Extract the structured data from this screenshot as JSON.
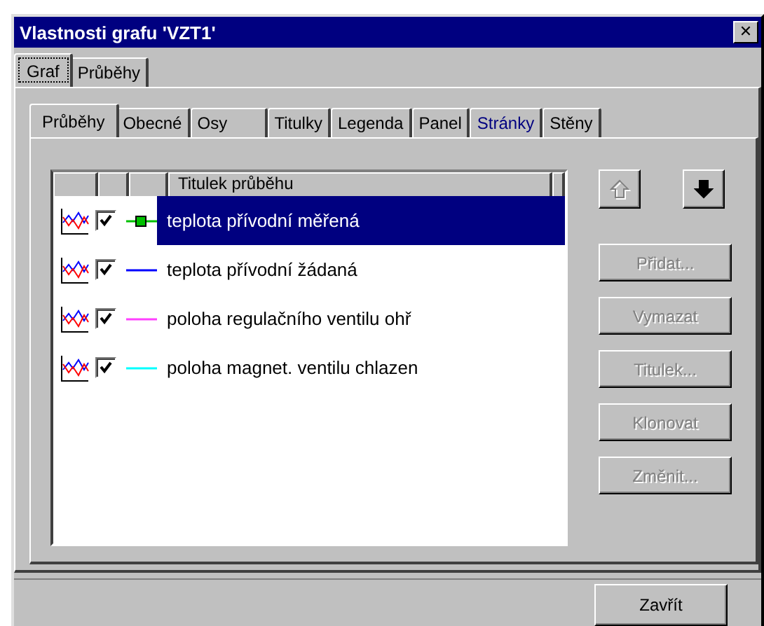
{
  "window": {
    "title": "Vlastnosti grafu 'VZT1'",
    "close": "✕"
  },
  "outer_tabs": [
    {
      "label": "Graf",
      "selected": true
    },
    {
      "label": "Průběhy",
      "selected": false
    }
  ],
  "inner_tabs": [
    {
      "label": "Průběhy",
      "selected": true,
      "hot": false
    },
    {
      "label": "Obecné",
      "selected": false,
      "hot": false
    },
    {
      "label": "Osy",
      "selected": false,
      "hot": false
    },
    {
      "label": "Titulky",
      "selected": false,
      "hot": false
    },
    {
      "label": "Legenda",
      "selected": false,
      "hot": false
    },
    {
      "label": "Panel",
      "selected": false,
      "hot": false
    },
    {
      "label": "Stránky",
      "selected": false,
      "hot": true
    },
    {
      "label": "Stěny",
      "selected": false,
      "hot": false
    }
  ],
  "table": {
    "columns": [
      "Titulek průběhu"
    ],
    "rows": [
      {
        "title": "teplota přívodní měřená",
        "checked": true,
        "color": "#00c000",
        "marker": true,
        "selected": true
      },
      {
        "title": "teplota přívodní žádaná",
        "checked": true,
        "color": "#0000ff",
        "marker": false,
        "selected": false
      },
      {
        "title": "poloha regulačního ventilu ohř",
        "checked": true,
        "color": "#ff40ff",
        "marker": false,
        "selected": false
      },
      {
        "title": "poloha magnet. ventilu chlazen",
        "checked": true,
        "color": "#00ffff",
        "marker": false,
        "selected": false
      }
    ]
  },
  "move_buttons": [
    {
      "kind": "up",
      "disabled": true
    },
    {
      "kind": "down",
      "disabled": false
    }
  ],
  "buttons": [
    {
      "label": "Přidat...",
      "disabled": true
    },
    {
      "label": "Vymazat",
      "disabled": true
    },
    {
      "label": "Titulek...",
      "disabled": true
    },
    {
      "label": "Klonovat",
      "disabled": true
    },
    {
      "label": "Změnit...",
      "disabled": true
    }
  ],
  "close_button": {
    "label": "Zavřít"
  }
}
